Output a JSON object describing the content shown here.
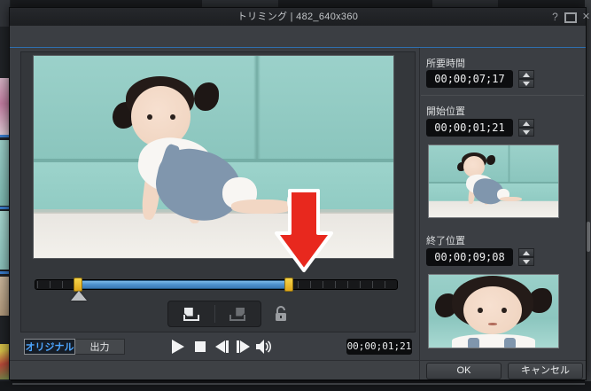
{
  "window": {
    "title": "トリミング | 482_640x360",
    "help_glyph": "?",
    "close_glyph": "✕"
  },
  "fields": {
    "duration": {
      "label": "所要時間",
      "value": "00;00;07;17"
    },
    "start": {
      "label": "開始位置",
      "value": "00;00;01;21"
    },
    "end": {
      "label": "終了位置",
      "value": "00;00;09;08"
    }
  },
  "timeline": {
    "trim_start_timecode": "00;00;01;21",
    "trim_end_timecode": "00;00;09;08",
    "selection_color": "#4f94cf",
    "handle_color": "#e8b41e"
  },
  "controls": {
    "tabs": [
      {
        "label": "オリジナル",
        "active": true
      },
      {
        "label": "出力",
        "active": false
      }
    ],
    "timecode": "00;00;01;21"
  },
  "footer": {
    "ok": "OK",
    "cancel": "キャンセル"
  },
  "colors": {
    "accent_blue": "#2f6fae",
    "tab_active_text": "#4da6ff",
    "arrow_red": "#e8281e",
    "sofa_teal": "#8ac5bd"
  }
}
